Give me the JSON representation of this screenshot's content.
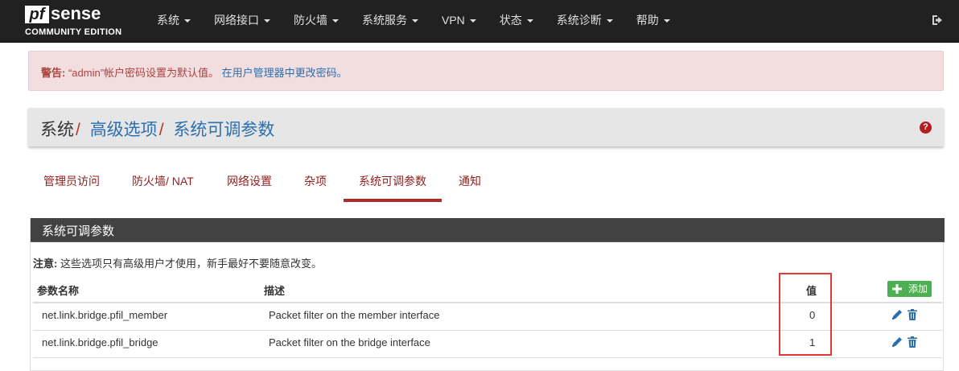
{
  "brand": {
    "logo_pf": "pf",
    "logo_sense": "sense",
    "edition": "COMMUNITY EDITION"
  },
  "nav": {
    "items": [
      {
        "label": "系统"
      },
      {
        "label": "网络接口"
      },
      {
        "label": "防火墙"
      },
      {
        "label": "系统服务"
      },
      {
        "label": "VPN"
      },
      {
        "label": "状态"
      },
      {
        "label": "系统诊断"
      },
      {
        "label": "帮助"
      }
    ],
    "logout_icon": "sign-out-icon"
  },
  "alert": {
    "prefix": "警告:",
    "message": " “admin”帐户密码设置为默认值。 ",
    "link": "在用户管理器中更改密码。"
  },
  "breadcrumb": {
    "first": "系统",
    "sep": "/",
    "second": "高级选项",
    "third": "系统可调参数",
    "help_icon": "question-circle-icon"
  },
  "tabs": [
    {
      "label": "管理员访问"
    },
    {
      "label": "防火墙/ NAT"
    },
    {
      "label": "网络设置"
    },
    {
      "label": "杂项"
    },
    {
      "label": "系统可调参数",
      "active": true
    },
    {
      "label": "通知"
    }
  ],
  "panel": {
    "title": "系统可调参数",
    "note_label": "注意:",
    "note_text": " 这些选项只有高级用户才使用，新手最好不要随意改变。",
    "columns": {
      "name": "参数名称",
      "description": "描述",
      "value": "值"
    },
    "add_button": "添加",
    "rows": [
      {
        "name": "net.link.bridge.pfil_member",
        "description": "Packet filter on the member interface",
        "value": "0"
      },
      {
        "name": "net.link.bridge.pfil_bridge",
        "description": "Packet filter on the bridge interface",
        "value": "1"
      }
    ]
  },
  "colors": {
    "navbar": "#212121",
    "accent_red": "#b02a2a",
    "link_blue": "#2b6fae",
    "add_green": "#4caf50",
    "highlight_box": "#e53935"
  }
}
